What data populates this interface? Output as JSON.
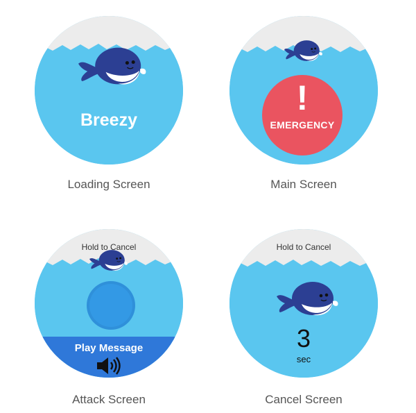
{
  "colors": {
    "water": "#5ac6ef",
    "foam": "#ececec",
    "whale": "#2c3f93",
    "belly": "#ffffff",
    "emergency": "#ea5460",
    "attack": "#3399e5",
    "play_band": "#2f78d9",
    "caption": "#555555"
  },
  "loading": {
    "app_name": "Breezy",
    "caption": "Loading Screen"
  },
  "main": {
    "bang": "!",
    "emergency_label": "EMERGENCY",
    "caption": "Main Screen"
  },
  "attack": {
    "hold_cancel": "Hold to Cancel",
    "play_label": "Play Message",
    "speaker_icon": "speaker-icon",
    "caption": "Attack Screen"
  },
  "cancel": {
    "hold_cancel": "Hold to Cancel",
    "countdown": "3",
    "unit": "sec",
    "caption": "Cancel Screen"
  }
}
